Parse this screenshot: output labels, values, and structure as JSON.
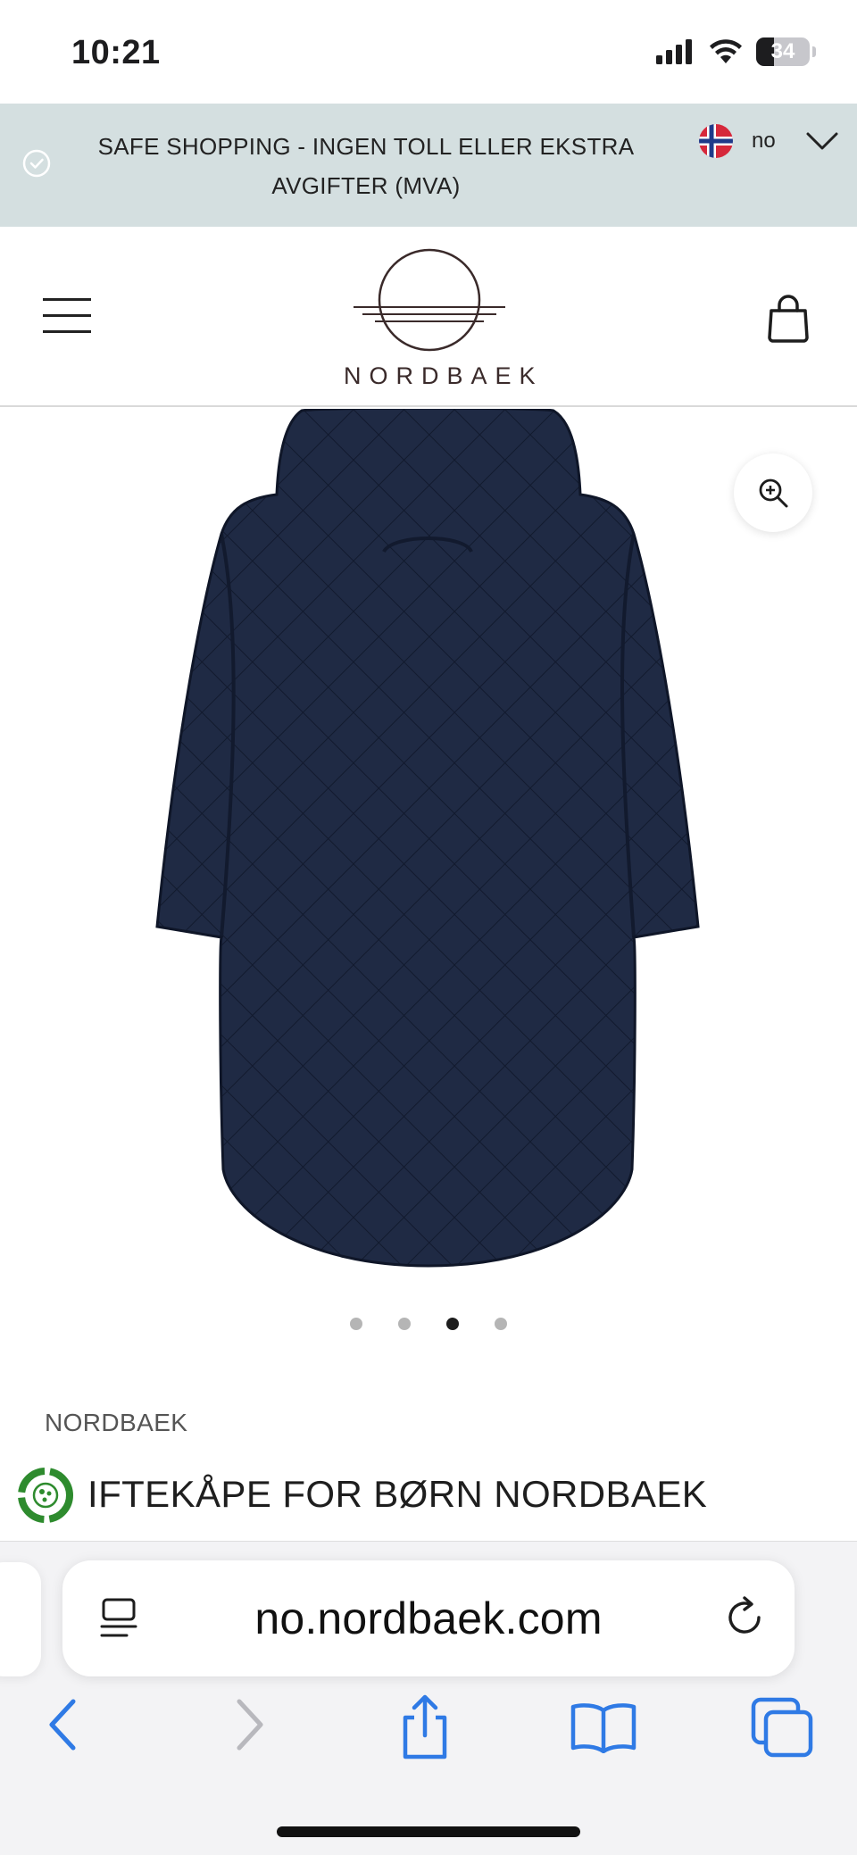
{
  "status_bar": {
    "time": "10:21",
    "battery_level": 34,
    "battery_label": "34",
    "icons": [
      "signal-icon",
      "wifi-icon",
      "battery-icon"
    ]
  },
  "banner": {
    "text": "SAFE SHOPPING - INGEN TOLL ELLER EKSTRA AVGIFTER (MVA)",
    "language_code": "no",
    "background_color": "#d4dfe0"
  },
  "header": {
    "logo_text": "NORDBAEK",
    "menu_icon": "hamburger-menu-icon",
    "cart_icon": "shopping-bag-icon"
  },
  "product": {
    "image_description": "navy-quilted-hooded-coat-back-view",
    "coat_color": "#1f2a44",
    "gallery_count": 4,
    "gallery_active_index": 2,
    "brand": "NORDBAEK",
    "title": "IFTEKÅPE FOR BØRN NORDBAEK"
  },
  "browser": {
    "url": "no.nordbaek.com",
    "accent_color": "#2f7ae5",
    "toolbar": [
      "back-icon",
      "forward-icon",
      "share-icon",
      "bookmarks-icon",
      "tabs-icon"
    ]
  }
}
